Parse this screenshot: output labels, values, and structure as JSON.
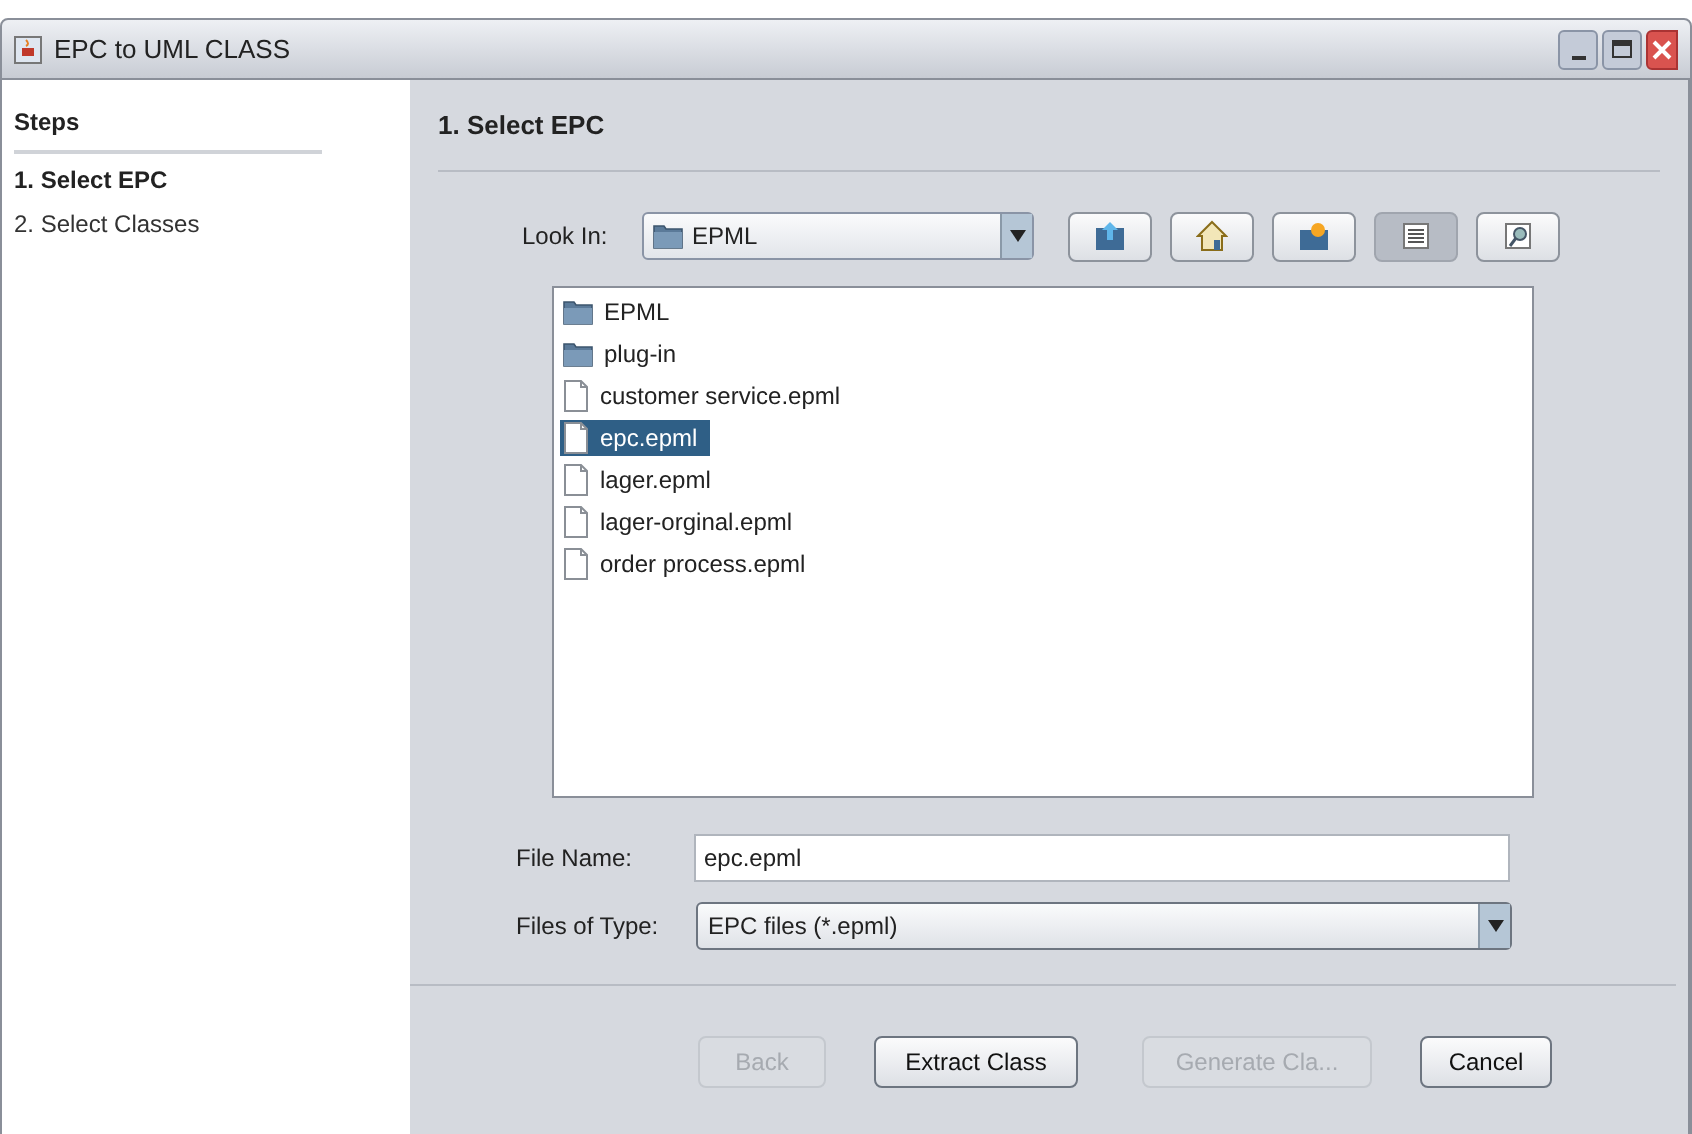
{
  "window": {
    "title": "EPC to UML CLASS"
  },
  "steps": {
    "title": "Steps",
    "items": [
      {
        "label": "1. Select EPC",
        "selected": true
      },
      {
        "label": "2. Select Classes",
        "selected": false
      }
    ]
  },
  "panel_title": "1. Select EPC",
  "look_in": {
    "label": "Look In:",
    "value": "EPML"
  },
  "toolbar": [
    {
      "kind": "up",
      "selected": false
    },
    {
      "kind": "home",
      "selected": false
    },
    {
      "kind": "new-folder",
      "selected": false
    },
    {
      "kind": "list",
      "selected": true
    },
    {
      "kind": "details",
      "selected": false
    }
  ],
  "files": [
    {
      "kind": "folder",
      "name": "EPML",
      "selected": false
    },
    {
      "kind": "folder",
      "name": "plug-in",
      "selected": false
    },
    {
      "kind": "file",
      "name": "customer service.epml",
      "selected": false
    },
    {
      "kind": "file",
      "name": "epc.epml",
      "selected": true
    },
    {
      "kind": "file",
      "name": "lager.epml",
      "selected": false
    },
    {
      "kind": "file",
      "name": "lager-orginal.epml",
      "selected": false
    },
    {
      "kind": "file",
      "name": "order process.epml",
      "selected": false
    }
  ],
  "file_name": {
    "label": "File Name:",
    "value": "epc.epml"
  },
  "file_type": {
    "label": "Files of Type:",
    "value": "EPC files (*.epml)"
  },
  "buttons": [
    {
      "label": "Back",
      "disabled": true
    },
    {
      "label": "Extract Class",
      "disabled": false
    },
    {
      "label": "Generate Cla...",
      "disabled": true
    },
    {
      "label": "Cancel",
      "disabled": false
    }
  ]
}
